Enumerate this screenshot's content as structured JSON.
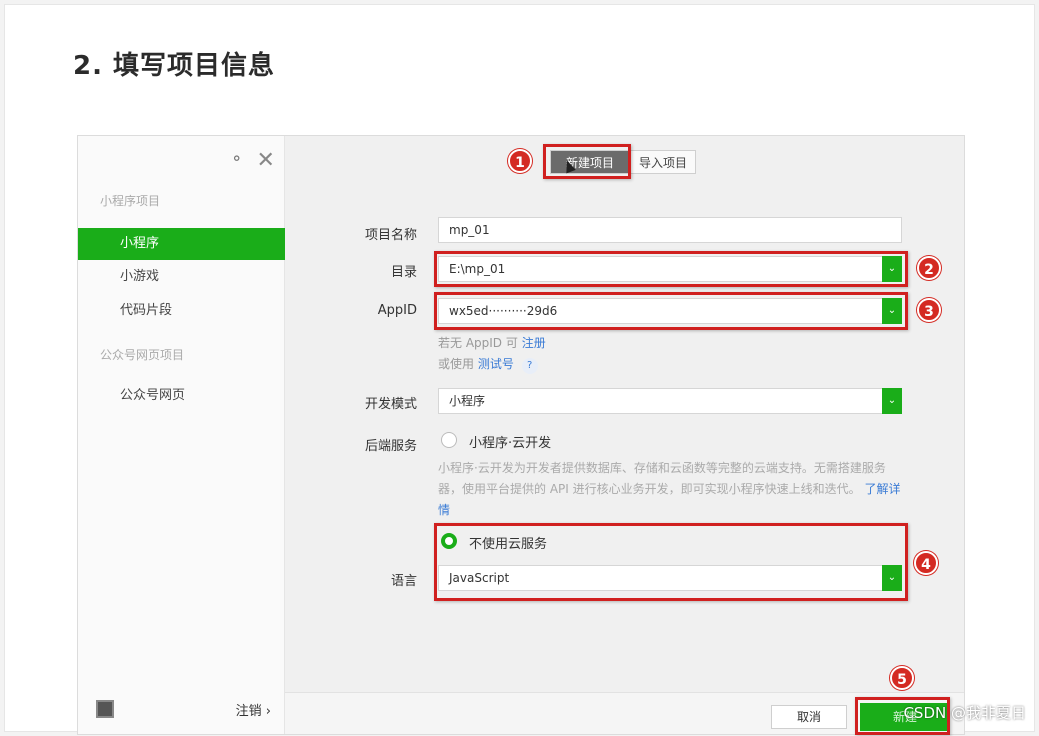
{
  "heading": "2. 填写项目信息",
  "sidebar": {
    "section1": "小程序项目",
    "items": [
      {
        "label": "小程序"
      },
      {
        "label": "小游戏"
      },
      {
        "label": "代码片段"
      }
    ],
    "section2": "公众号网页项目",
    "items2": [
      {
        "label": "公众号网页"
      }
    ],
    "logout": "注销 ›"
  },
  "tabs": {
    "new_project": "新建项目",
    "import_project": "导入项目"
  },
  "form": {
    "name_label": "项目名称",
    "name_value": "mp_01",
    "dir_label": "目录",
    "dir_value": "E:\\mp_01",
    "appid_label": "AppID",
    "appid_value": "wx5ed··········29d6",
    "appid_hint_prefix": "若无 AppID 可",
    "appid_hint_link": "注册",
    "test_hint_prefix": "或使用",
    "test_hint_link": "测试号",
    "test_help": "?",
    "mode_label": "开发模式",
    "mode_value": "小程序",
    "backend_label": "后端服务",
    "cloud_option": "小程序·云开发",
    "cloud_desc": "小程序·云开发为开发者提供数据库、存储和云函数等完整的云端支持。无需搭建服务器，使用平台提供的 API 进行核心业务开发，即可实现小程序快速上线和迭代。",
    "cloud_desc_link": "了解详情",
    "no_cloud_option": "不使用云服务",
    "lang_label": "语言",
    "lang_value": "JavaScript"
  },
  "badges": [
    "1",
    "2",
    "3",
    "4",
    "5"
  ],
  "footer": {
    "cancel": "取消",
    "confirm": "新建"
  },
  "watermark": "CSDN @我非夏日",
  "colors": {
    "accent": "#1aad19",
    "annotation": "#d0201f"
  }
}
